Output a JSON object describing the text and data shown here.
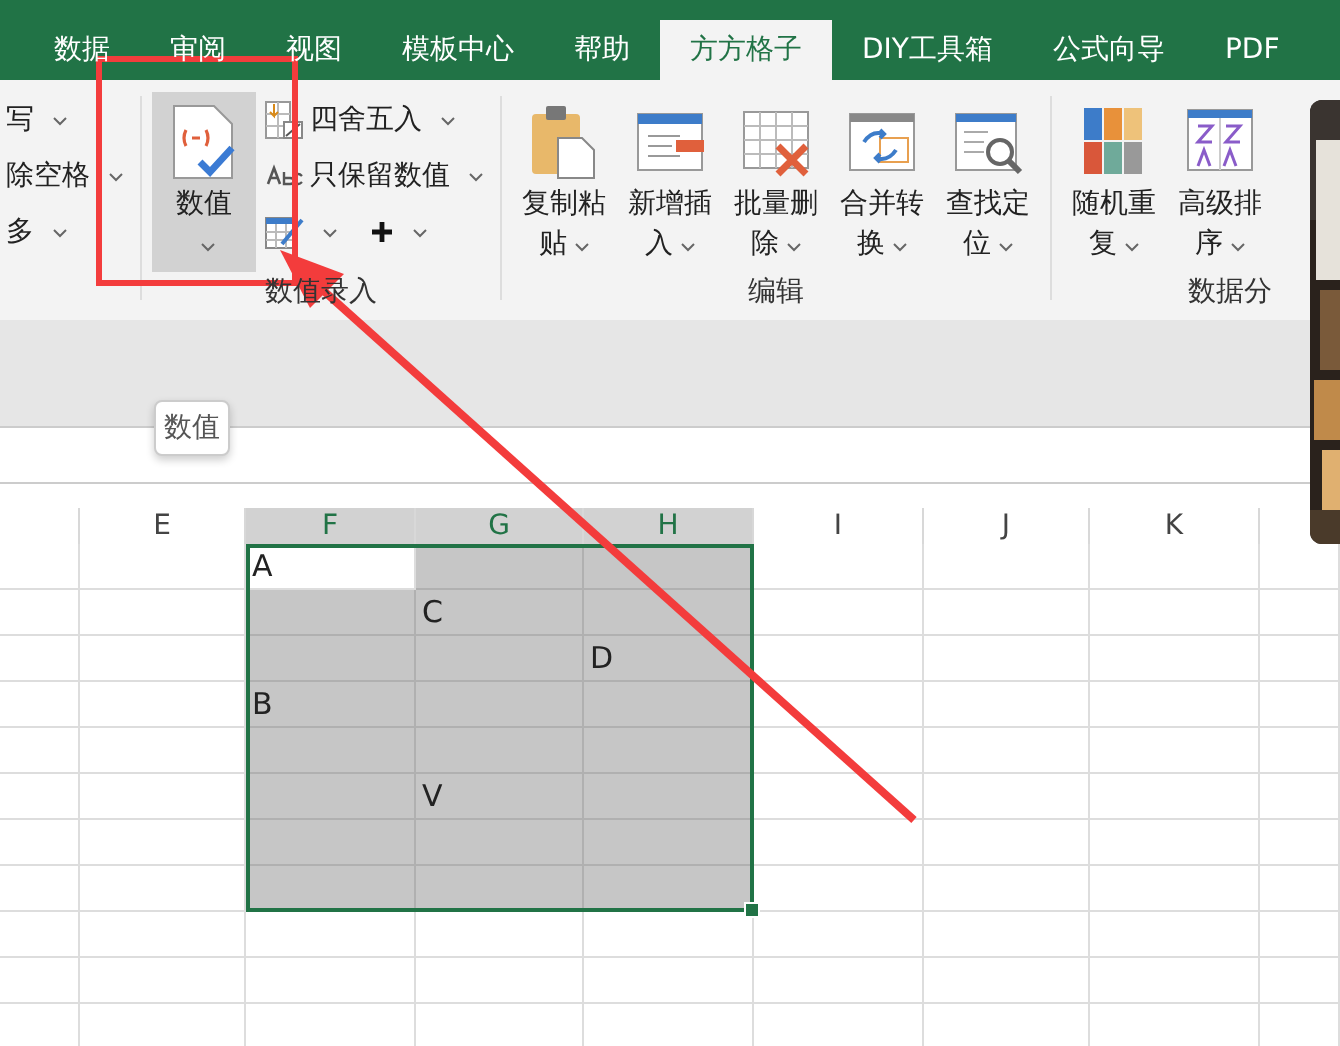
{
  "tabs": [
    {
      "label": "数据",
      "selected": false
    },
    {
      "label": "审阅",
      "selected": false
    },
    {
      "label": "视图",
      "selected": false
    },
    {
      "label": "模板中心",
      "selected": false
    },
    {
      "label": "帮助",
      "selected": false
    },
    {
      "label": "方方格子",
      "selected": true
    },
    {
      "label": "DIY工具箱",
      "selected": false
    },
    {
      "label": "公式向导",
      "selected": false
    },
    {
      "label": "PDF",
      "selected": false
    }
  ],
  "ribbon": {
    "groups": [
      {
        "items": [
          {
            "kind": "small",
            "label": "写",
            "selected": false
          },
          {
            "kind": "small",
            "label": "除空格",
            "selected": false
          },
          {
            "kind": "small",
            "label": "多",
            "selected": false
          }
        ]
      },
      {
        "label": "数值录入",
        "items": [
          {
            "kind": "large",
            "label": "数值",
            "selected": true
          },
          {
            "kind": "small",
            "label": "四舍五入",
            "selected": false
          },
          {
            "kind": "small",
            "label": "只保留数值",
            "selected": false
          },
          {
            "kind": "icon_pair",
            "selected": false
          }
        ]
      },
      {
        "label": "编辑",
        "items": [
          {
            "kind": "large",
            "label": "复制粘贴",
            "selected": false
          },
          {
            "kind": "large",
            "label": "新增插入",
            "selected": false
          },
          {
            "kind": "large",
            "label": "批量删除",
            "selected": false
          },
          {
            "kind": "large",
            "label": "合并转换",
            "selected": false
          },
          {
            "kind": "large",
            "label": "查找定位",
            "selected": false
          }
        ]
      },
      {
        "label": "数据分",
        "items": [
          {
            "kind": "large",
            "label": "随机重复",
            "selected": false
          },
          {
            "kind": "large",
            "label": "高级排序",
            "selected": false
          }
        ]
      }
    ]
  },
  "tooltip": "数值",
  "sheet": {
    "columns": [
      {
        "selected": false
      },
      {
        "label": "E",
        "selected": false
      },
      {
        "label": "F",
        "selected": true
      },
      {
        "label": "G",
        "selected": true
      },
      {
        "label": "H",
        "selected": true
      },
      {
        "label": "I",
        "selected": false
      },
      {
        "label": "J",
        "selected": false
      },
      {
        "label": "K",
        "selected": false
      },
      {
        "selected": false
      }
    ],
    "rows": [
      {
        "selected": true,
        "cells": [
          null,
          null,
          {
            "text": "A",
            "active": true
          },
          null,
          null,
          null,
          null,
          null,
          null
        ]
      },
      {
        "selected": true,
        "cells": [
          null,
          null,
          null,
          {
            "text": "C",
            "active": false
          },
          null,
          null,
          null,
          null,
          null
        ]
      },
      {
        "selected": true,
        "cells": [
          null,
          null,
          null,
          null,
          {
            "text": "D",
            "active": false
          },
          null,
          null,
          null,
          null
        ]
      },
      {
        "selected": true,
        "cells": [
          null,
          null,
          {
            "text": "B",
            "active": false
          },
          null,
          null,
          null,
          null,
          null,
          null
        ]
      },
      {
        "selected": true,
        "cells": [
          null,
          null,
          null,
          null,
          null,
          null,
          null,
          null,
          null
        ]
      },
      {
        "selected": true,
        "cells": [
          null,
          null,
          null,
          {
            "text": "V",
            "active": false
          },
          null,
          null,
          null,
          null,
          null
        ]
      },
      {
        "selected": true,
        "cells": [
          null,
          null,
          null,
          null,
          null,
          null,
          null,
          null,
          null
        ]
      },
      {
        "selected": true,
        "cells": [
          null,
          null,
          null,
          null,
          null,
          null,
          null,
          null,
          null
        ]
      },
      {
        "selected": false,
        "cells": [
          null,
          null,
          null,
          null,
          null,
          null,
          null,
          null,
          null
        ]
      },
      {
        "selected": false,
        "cells": [
          null,
          null,
          null,
          null,
          null,
          null,
          null,
          null,
          null
        ]
      },
      {
        "selected": false,
        "cells": [
          null,
          null,
          null,
          null,
          null,
          null,
          null,
          null,
          null
        ]
      }
    ]
  }
}
